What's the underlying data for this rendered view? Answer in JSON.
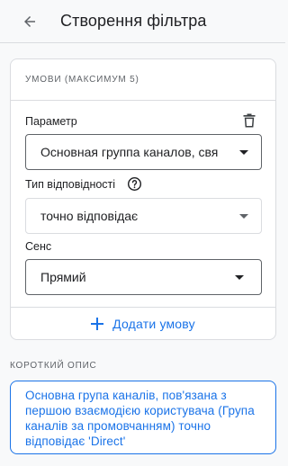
{
  "header": {
    "title": "Створення фільтра",
    "back_icon": "arrow-back-icon"
  },
  "conditions": {
    "caption": "УМОВИ (МАКСИМУМ 5)",
    "parameter": {
      "label": "Параметр",
      "value": "Основная группа каналов, свя",
      "delete_icon": "trash-icon"
    },
    "match_type": {
      "label": "Тип відповідності",
      "help_icon": "help-circle-icon",
      "value": "точно відповідає"
    },
    "sense": {
      "label": "Сенс",
      "value": "Прямий"
    },
    "add_condition": {
      "icon": "plus-icon",
      "label": "Додати умову"
    }
  },
  "summary": {
    "caption": "КОРОТКИЙ ОПИС",
    "text": "Основна група каналів, пов'язана з першою взаємодією користувача (Група каналів за промовчанням) точно відповідає 'Direct'"
  },
  "colors": {
    "accent": "#1a73e8",
    "border": "#dadce0",
    "background": "#f8f9fa",
    "text": "#202124",
    "muted": "#5f6368"
  }
}
